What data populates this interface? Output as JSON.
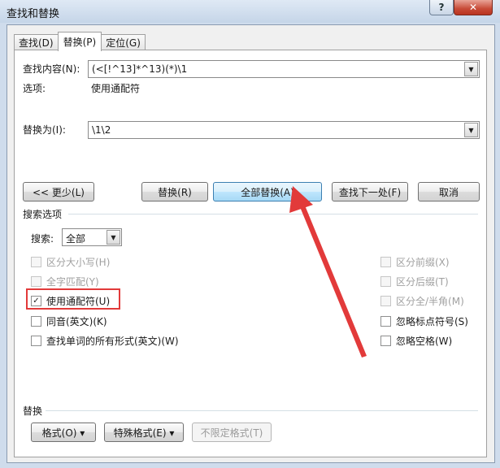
{
  "window": {
    "title": "查找和替换",
    "help_label": "?",
    "close_label": "✕"
  },
  "tabs": [
    {
      "label": "查找(D)",
      "active": false
    },
    {
      "label": "替换(P)",
      "active": true
    },
    {
      "label": "定位(G)",
      "active": false
    }
  ],
  "find": {
    "label": "查找内容(N):",
    "value": "(<[!^13]*^13)(*)\\1",
    "options_label": "选项:",
    "options_value": "使用通配符"
  },
  "replace": {
    "label": "替换为(I):",
    "value": "\\1\\2"
  },
  "buttons": {
    "less": "<< 更少(L)",
    "replace": "替换(R)",
    "replace_all": "全部替换(A)",
    "find_next": "查找下一处(F)",
    "cancel": "取消"
  },
  "search_options": {
    "title": "搜索选项",
    "search_label": "搜索:",
    "search_value": "全部",
    "left_checks": [
      {
        "label": "区分大小写(H)",
        "checked": false,
        "disabled": true
      },
      {
        "label": "全字匹配(Y)",
        "checked": false,
        "disabled": true
      },
      {
        "label": "使用通配符(U)",
        "checked": true,
        "disabled": false
      },
      {
        "label": "同音(英文)(K)",
        "checked": false,
        "disabled": false
      },
      {
        "label": "查找单词的所有形式(英文)(W)",
        "checked": false,
        "disabled": false
      }
    ],
    "right_checks": [
      {
        "label": "区分前缀(X)",
        "checked": false,
        "disabled": true
      },
      {
        "label": "区分后缀(T)",
        "checked": false,
        "disabled": true
      },
      {
        "label": "区分全/半角(M)",
        "checked": false,
        "disabled": true
      },
      {
        "label": "忽略标点符号(S)",
        "checked": false,
        "disabled": false
      },
      {
        "label": "忽略空格(W)",
        "checked": false,
        "disabled": false
      }
    ]
  },
  "replace_group": {
    "title": "替换",
    "format": "格式(O) ▾",
    "special": "特殊格式(E) ▾",
    "no_format": "不限定格式(T)"
  },
  "annotation": {
    "color": "#e23a3a"
  }
}
